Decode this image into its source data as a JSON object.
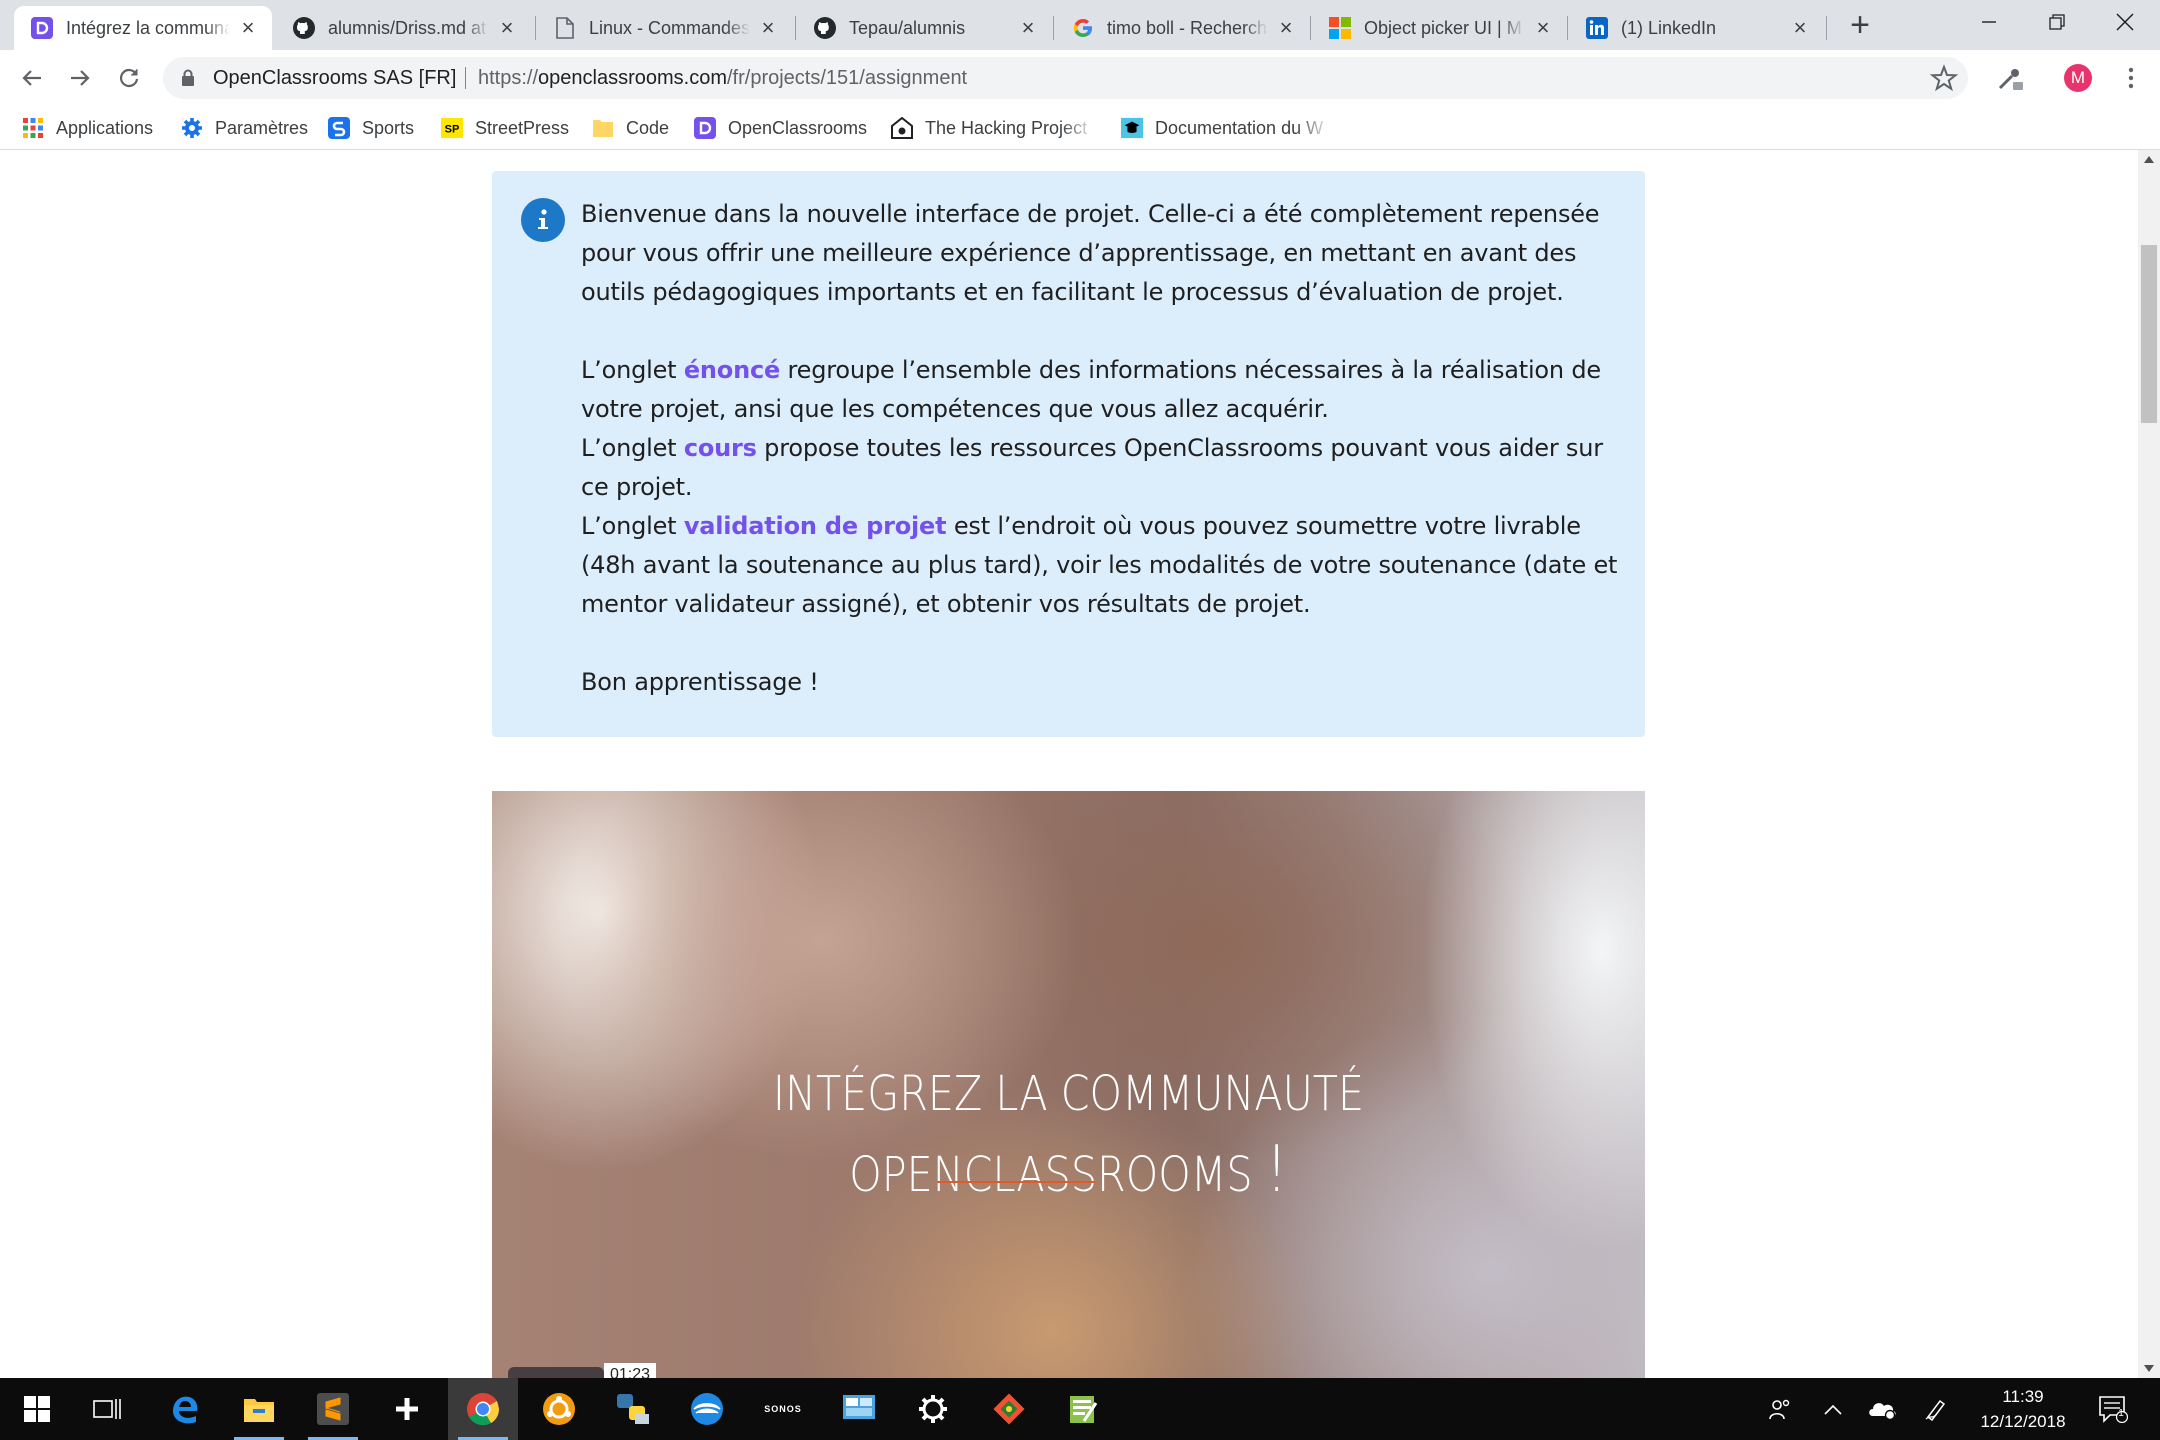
{
  "browser": {
    "tabs": [
      {
        "title": "Intégrez la communauté",
        "favicon": "openclassrooms-icon",
        "active": true
      },
      {
        "title": "alumnis/Driss.md at",
        "favicon": "github-icon",
        "active": false
      },
      {
        "title": "Linux - Commandes",
        "favicon": "document-icon",
        "active": false
      },
      {
        "title": "Tepau/alumnis",
        "favicon": "github-icon",
        "active": false
      },
      {
        "title": "timo boll - Recherch",
        "favicon": "google-icon",
        "active": false
      },
      {
        "title": "Object picker UI | M",
        "favicon": "microsoft-icon",
        "active": false
      },
      {
        "title": "(1) LinkedIn",
        "favicon": "linkedin-icon",
        "active": false
      }
    ],
    "site_identity": "OpenClassrooms SAS [FR]",
    "url": {
      "scheme": "https://",
      "host": "openclassrooms.com",
      "path": "/fr/projects/151/assignment"
    },
    "profile_initial": "M",
    "bookmarks": [
      {
        "label": "Applications",
        "icon": "apps-grid-icon"
      },
      {
        "label": "Paramètres",
        "icon": "gear-icon"
      },
      {
        "label": "Sports",
        "icon": "sports-icon"
      },
      {
        "label": "StreetPress",
        "icon": "streetpress-icon"
      },
      {
        "label": "Code",
        "icon": "folder-icon"
      },
      {
        "label": "OpenClassrooms",
        "icon": "openclassrooms-icon"
      },
      {
        "label": "The Hacking Project",
        "icon": "hacking-project-icon"
      },
      {
        "label": "Documentation du W",
        "icon": "documentation-icon"
      }
    ]
  },
  "info_box": {
    "icon": "info-icon",
    "intro": "Bienvenue dans la nouvelle interface de projet. Celle-ci a été complètement repensée pour vous offrir une meilleure expérience d’apprentissage, en mettant en avant des outils pédagogiques importants et en facilitant le processus d’évaluation de projet.",
    "p1_prefix": "L’onglet ",
    "p1_link": "énoncé",
    "p1_suffix": " regroupe l’ensemble des informations nécessaires à la réalisation de votre projet, ansi que les compétences que vous allez acquérir.",
    "p2_prefix": "L’onglet ",
    "p2_link": "cours",
    "p2_suffix": " propose toutes les ressources OpenClassrooms pouvant vous aider sur ce projet.",
    "p3_prefix": "L’onglet ",
    "p3_link": "validation de projet",
    "p3_suffix": " est l’endroit où vous pouvez soumettre votre livrable (48h avant la soutenance au plus tard), voir les modalités de votre soutenance (date et mentor validateur assigné), et obtenir vos résultats de projet.",
    "closing": "Bon apprentissage !",
    "link_color": "#7451eb",
    "background": "#dcedfc"
  },
  "video": {
    "title_line1": "INTÉGREZ LA COMMUNAUTÉ",
    "title_line2": "OPENCLASSROOMS",
    "title_bang": "!",
    "duration": "01:23",
    "underline_color": "#e25a2c"
  },
  "taskbar": {
    "apps": [
      "windows-start-icon",
      "task-view-icon",
      "edge-icon",
      "file-explorer-icon",
      "sublime-text-icon",
      "plus-app-icon",
      "chrome-icon",
      "ubuntu-icon",
      "python-icon",
      "network-app-icon",
      "sonos-icon",
      "control-panel-icon",
      "settings-icon",
      "git-icon",
      "notepad-icon"
    ],
    "sonos_label": "SONOS",
    "time": "11:39",
    "date": "12/12/2018",
    "notification_count": "1"
  }
}
